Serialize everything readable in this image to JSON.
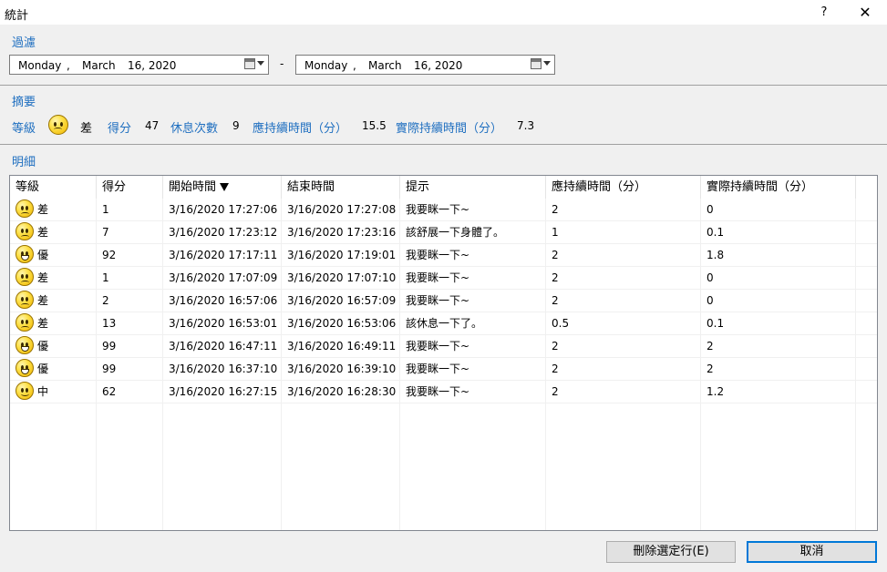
{
  "window": {
    "title": "統計",
    "help_label": "?",
    "close_label": "✕"
  },
  "filter": {
    "section_label": "過濾",
    "from": {
      "weekday": "Monday",
      "sep": ",",
      "month": "March",
      "day_year": "16, 2020"
    },
    "to": {
      "weekday": "Monday",
      "sep": ",",
      "month": "March",
      "day_year": "16, 2020"
    },
    "range_sep": "-"
  },
  "summary": {
    "section_label": "摘要",
    "grade_label": "等級",
    "grade_icon": "sad-face-icon",
    "grade_value": "差",
    "score_label": "得分",
    "score_value": "47",
    "breaks_label": "休息次數",
    "breaks_value": "9",
    "expected_label": "應持續時間（分）",
    "expected_value": "15.5",
    "actual_label": "實際持續時間（分）",
    "actual_value": "7.3"
  },
  "detail": {
    "section_label": "明細",
    "columns": [
      "等級",
      "得分",
      "開始時間",
      "結束時間",
      "提示",
      "應持續時間（分）",
      "實際持續時間（分）"
    ],
    "rows": [
      {
        "icon": "sad-face-icon",
        "grade": "差",
        "score": "1",
        "start": "3/16/2020 17:27:06",
        "end": "3/16/2020 17:27:08",
        "hint": "我要眯一下~",
        "expected": "2",
        "actual": "0"
      },
      {
        "icon": "sad-face-icon",
        "grade": "差",
        "score": "7",
        "start": "3/16/2020 17:23:12",
        "end": "3/16/2020 17:23:16",
        "hint": "該舒展一下身體了。",
        "expected": "1",
        "actual": "0.1"
      },
      {
        "icon": "happy-face-icon",
        "grade": "優",
        "score": "92",
        "start": "3/16/2020 17:17:11",
        "end": "3/16/2020 17:19:01",
        "hint": "我要眯一下~",
        "expected": "2",
        "actual": "1.8"
      },
      {
        "icon": "sad-face-icon",
        "grade": "差",
        "score": "1",
        "start": "3/16/2020 17:07:09",
        "end": "3/16/2020 17:07:10",
        "hint": "我要眯一下~",
        "expected": "2",
        "actual": "0"
      },
      {
        "icon": "sad-face-icon",
        "grade": "差",
        "score": "2",
        "start": "3/16/2020 16:57:06",
        "end": "3/16/2020 16:57:09",
        "hint": "我要眯一下~",
        "expected": "2",
        "actual": "0"
      },
      {
        "icon": "sad-face-icon",
        "grade": "差",
        "score": "13",
        "start": "3/16/2020 16:53:01",
        "end": "3/16/2020 16:53:06",
        "hint": "該休息一下了。",
        "expected": "0.5",
        "actual": "0.1"
      },
      {
        "icon": "happy-face-icon",
        "grade": "優",
        "score": "99",
        "start": "3/16/2020 16:47:11",
        "end": "3/16/2020 16:49:11",
        "hint": "我要眯一下~",
        "expected": "2",
        "actual": "2"
      },
      {
        "icon": "happy-face-icon",
        "grade": "優",
        "score": "99",
        "start": "3/16/2020 16:37:10",
        "end": "3/16/2020 16:39:10",
        "hint": "我要眯一下~",
        "expected": "2",
        "actual": "2"
      },
      {
        "icon": "smile-face-icon",
        "grade": "中",
        "score": "62",
        "start": "3/16/2020 16:27:15",
        "end": "3/16/2020 16:28:30",
        "hint": "我要眯一下~",
        "expected": "2",
        "actual": "1.2"
      }
    ]
  },
  "buttons": {
    "delete_label": "刪除選定行(E)",
    "cancel_label": "取消"
  }
}
